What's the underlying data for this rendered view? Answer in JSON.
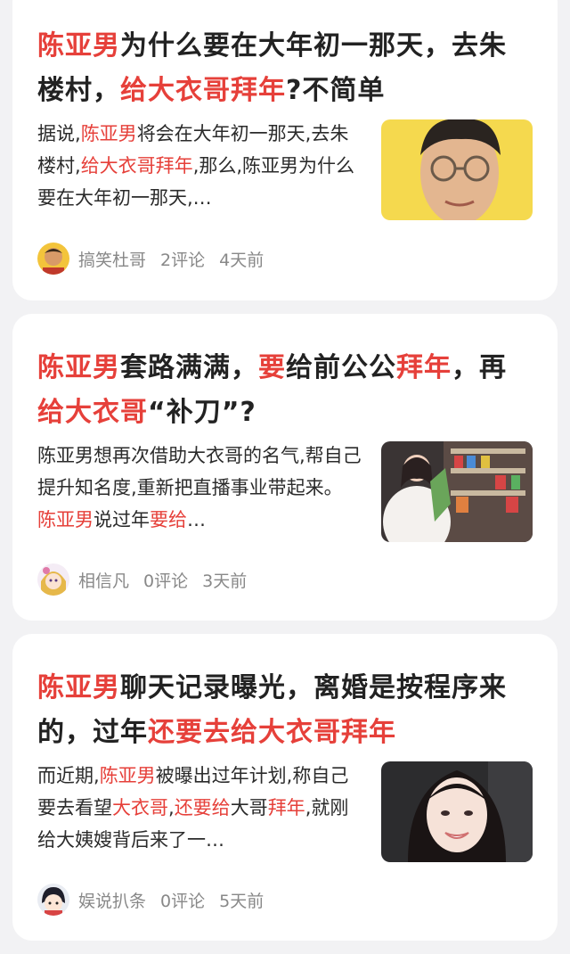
{
  "feed": {
    "articles": [
      {
        "title_runs": [
          {
            "text": "陈亚男",
            "hl": true
          },
          {
            "text": "为什么要在大年初一那天，去朱楼村，",
            "hl": false
          },
          {
            "text": "给大衣哥拜年",
            "hl": true
          },
          {
            "text": "?不简单",
            "hl": false
          }
        ],
        "summary_runs": [
          {
            "text": "据说,",
            "hl": false
          },
          {
            "text": "陈亚男",
            "hl": true
          },
          {
            "text": "将会在大年初一那天,去朱楼村,",
            "hl": false
          },
          {
            "text": "给大衣哥拜年",
            "hl": true
          },
          {
            "text": ",那么,陈亚男为什么要在大年初一那天,…",
            "hl": false
          }
        ],
        "author": "搞笑杜哥",
        "comments": "2评论",
        "time": "4天前",
        "thumb_icon": "man-glasses-photo",
        "avatar_icon": "man-avatar"
      },
      {
        "title_runs": [
          {
            "text": "陈亚男",
            "hl": true
          },
          {
            "text": "套路满满，",
            "hl": false
          },
          {
            "text": "要",
            "hl": true
          },
          {
            "text": "给前公公",
            "hl": false
          },
          {
            "text": "拜年",
            "hl": true
          },
          {
            "text": "，再",
            "hl": false
          },
          {
            "text": "给大衣哥",
            "hl": true
          },
          {
            "text": "“补刀”?",
            "hl": false
          }
        ],
        "summary_runs": [
          {
            "text": "陈亚男想再次借助大衣哥的名气,帮自己提升知名度,重新把直播事业带起来。 ",
            "hl": false
          },
          {
            "text": "陈亚男",
            "hl": true
          },
          {
            "text": "说过年",
            "hl": false
          },
          {
            "text": "要给",
            "hl": true
          },
          {
            "text": "…",
            "hl": false
          }
        ],
        "author": "相信凡",
        "comments": "0评论",
        "time": "3天前",
        "thumb_icon": "woman-store-photo",
        "avatar_icon": "cartoon-girl-avatar"
      },
      {
        "title_runs": [
          {
            "text": "陈亚男",
            "hl": true
          },
          {
            "text": "聊天记录曝光，离婚是按程序来的，过年",
            "hl": false
          },
          {
            "text": "还要去给大衣哥拜年",
            "hl": true
          }
        ],
        "summary_runs": [
          {
            "text": "而近期,",
            "hl": false
          },
          {
            "text": "陈亚男",
            "hl": true
          },
          {
            "text": "被曝出过年计划,称自己要去看望",
            "hl": false
          },
          {
            "text": "大衣哥",
            "hl": true
          },
          {
            "text": ",",
            "hl": false
          },
          {
            "text": "还要给",
            "hl": true
          },
          {
            "text": "大哥",
            "hl": false
          },
          {
            "text": "拜年",
            "hl": true
          },
          {
            "text": ",就刚给大姨嫂背后来了一…",
            "hl": false
          }
        ],
        "author": "娱说扒条",
        "comments": "0评论",
        "time": "5天前",
        "thumb_icon": "woman-smiling-photo",
        "avatar_icon": "cartoon-kid-avatar"
      }
    ]
  },
  "colors": {
    "highlight": "#e6403a",
    "background": "#f2f2f4",
    "card": "#ffffff",
    "meta": "#888888"
  }
}
